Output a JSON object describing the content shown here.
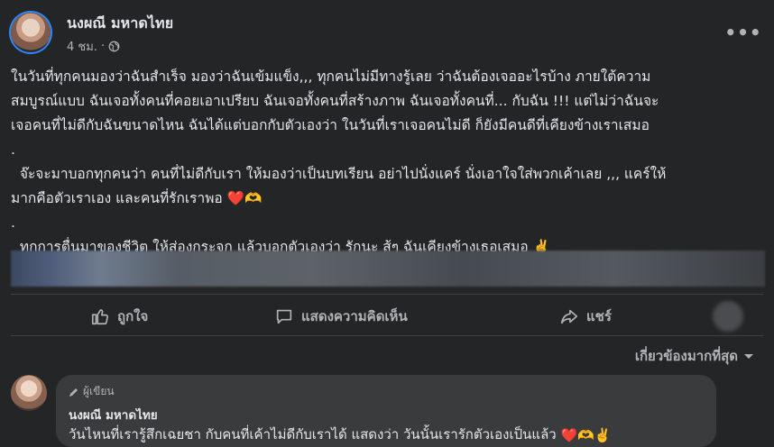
{
  "post": {
    "author": "นงผณี มหาดไทย",
    "time": "4 ชม.",
    "privacy_icon": "globe-icon",
    "more_icon": "more-icon",
    "body_lines": [
      "ในวันที่ทุกคนมองว่าฉันสำเร็จ มองว่าฉันเข้มแข็ง,,, ทุกคนไม่มีทางรู้เลย ว่าฉันต้องเจออะไรบ้าง ภายใต้ความ",
      "สมบูรณ์แบบ ฉันเจอทั้งคนที่คอยเอาเปรียบ ฉันเจอทั้งคนที่สร้างภาพ ฉันเจอทั้งคนที่... กับฉัน !!! แต่ไม่ว่าฉันจะ",
      "เจอคนที่ไม่ดีกับฉันขนาดไหน ฉันได้แต่บอกกับตัวเองว่า ในวันที่เราเจอคนไม่ดี ก็ยังมีคนดีที่เคียงข้างเราเสมอ",
      ".",
      "  จ๊ะจะมาบอกทุกคนว่า คนที่ไม่ดีกับเรา ให้มองว่าเป็นบทเรียน อย่าไปนั่งแคร์ นั่งเอาใจใส่พวกเค้าเลย ,,, แคร์ให้",
      "มากคือตัวเราเอง และคนที่รักเราพอ",
      ".",
      "  ทุกการตื่นมาของชีวิต ให้ส่องกระจก แล้วบอกตัวเองว่า รักนะ สู้ๆ ฉันเคียงข้างเธอเสมอ"
    ],
    "emoji_line6": "❤️🫶",
    "emoji_line8": "✌️"
  },
  "actions": {
    "like": "ถูกใจ",
    "comment": "แสดงความคิดเห็น",
    "share": "แชร์"
  },
  "comments": {
    "sort_label": "เกี่ยวข้องมากที่สุด",
    "items": [
      {
        "badge": "ผู้เขียน",
        "name": "นงผณี มหาดไทย",
        "text": "วันไหนที่เรารู้สึกเฉยชา กับคนที่เค้าไม่ดีกับเราได้ แสดงว่า วันนั้นเรารักตัวเองเป็นแล้ว",
        "emoji": "❤️🫶✌️"
      }
    ]
  },
  "colors": {
    "background": "#242526",
    "text_primary": "#e4e6eb",
    "text_secondary": "#b0b3b8",
    "comment_bubble": "#3a3b3c"
  }
}
